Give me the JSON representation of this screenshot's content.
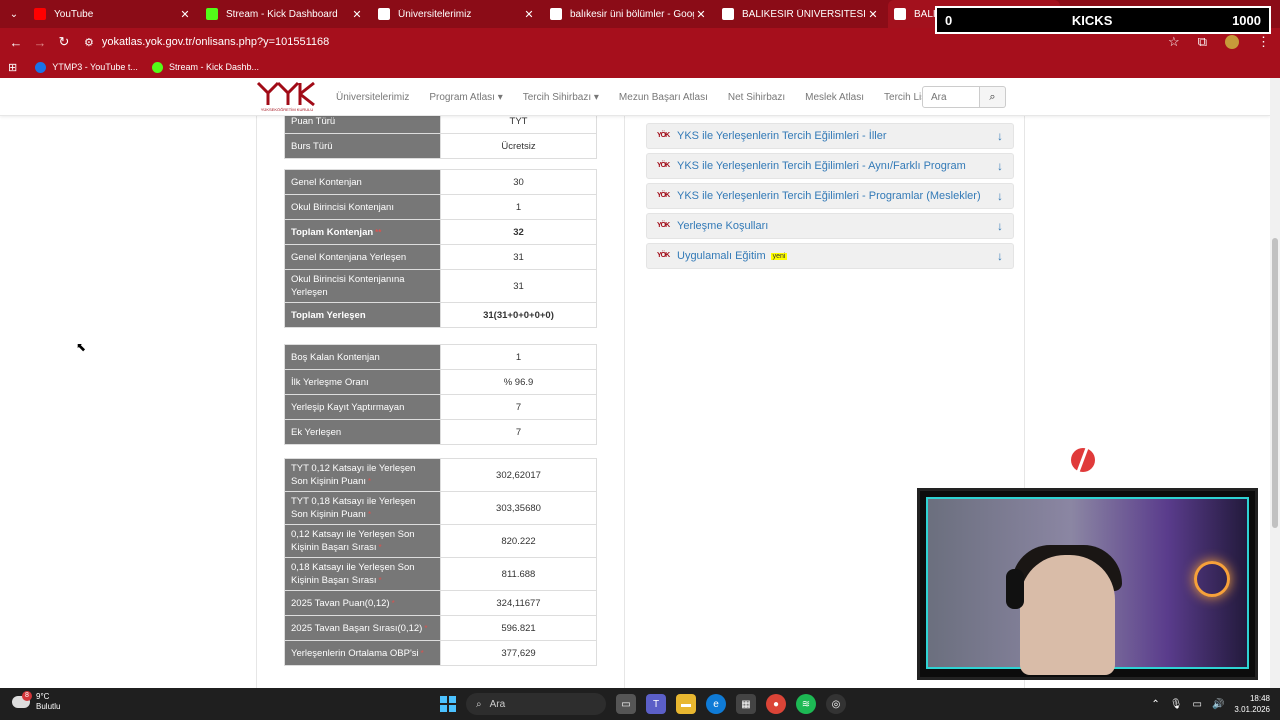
{
  "browser": {
    "tabs": [
      {
        "title": "YouTube",
        "icon": "youtube-icon",
        "active": false
      },
      {
        "title": "Stream - Kick Dashboard",
        "icon": "kick-icon",
        "active": false
      },
      {
        "title": "Üniversitelerimiz",
        "icon": "yok-icon",
        "active": false
      },
      {
        "title": "balıkesir üni bölümler - Google",
        "icon": "google-icon",
        "active": false
      },
      {
        "title": "BALIKESİR ÜNİVERSİTESİ'ndeki",
        "icon": "yok-icon",
        "active": false
      },
      {
        "title": "BALIKESİR ÜNİVERSİTESİ - Bal",
        "icon": "yok-icon",
        "active": true
      }
    ],
    "url": "yokatlas.yok.gov.tr/onlisans.php?y=101551168",
    "bookmarks": [
      {
        "label": "YTMP3 - YouTube t...",
        "color": "#1a73e8"
      },
      {
        "label": "Stream - Kick Dashb...",
        "color": "#53fc18"
      }
    ]
  },
  "kicks_overlay": {
    "left": "0",
    "title": "KICKS",
    "right": "1000"
  },
  "site": {
    "logo_text": "YÜKSEKÖĞRETİM KURULU",
    "menu": [
      "Üniversitelerimiz",
      "Program Atlası ▾",
      "Tercih Sihirbazı ▾",
      "Mezun Başarı Atlası",
      "Net Sihirbazı",
      "Meslek Atlası",
      "Tercih Listem"
    ],
    "search_placeholder": "Ara"
  },
  "table1": [
    {
      "label": "Puan Türü",
      "value": "TYT"
    },
    {
      "label": "Burs Türü",
      "value": "Ücretsiz"
    }
  ],
  "table2": [
    {
      "label": "Genel Kontenjan",
      "value": "30"
    },
    {
      "label": "Okul Birincisi Kontenjanı",
      "value": "1"
    },
    {
      "label": "Toplam Kontenjan",
      "value": "32",
      "mark": "**"
    },
    {
      "label": "Genel Kontenjana Yerleşen",
      "value": "31"
    },
    {
      "label": "Okul Birincisi Kontenjanına Yerleşen",
      "value": "31"
    },
    {
      "label": "Toplam Yerleşen",
      "value": "31(31+0+0+0+0)"
    }
  ],
  "table3": [
    {
      "label": "Boş Kalan Kontenjan",
      "value": "1"
    },
    {
      "label": "İlk Yerleşme Oranı",
      "value": "% 96.9"
    },
    {
      "label": "Yerleşip Kayıt Yaptırmayan",
      "value": "7"
    },
    {
      "label": "Ek Yerleşen",
      "value": "7"
    }
  ],
  "table4": [
    {
      "label": "TYT 0,12 Katsayı ile Yerleşen Son Kişinin Puanı",
      "value": "302,62017",
      "mark": "*"
    },
    {
      "label": "TYT 0,18 Katsayı ile Yerleşen Son Kişinin Puanı",
      "value": "303,35680",
      "mark": "*"
    },
    {
      "label": "0,12 Katsayı ile Yerleşen Son Kişinin Başarı Sırası",
      "value": "820.222",
      "mark": "*"
    },
    {
      "label": "0,18 Katsayı ile Yerleşen Son Kişinin Başarı Sırası",
      "value": "811.688",
      "mark": "*"
    },
    {
      "label": "2025 Tavan Puan(0,12)",
      "value": "324,11677",
      "mark": "*"
    },
    {
      "label": "2025 Tavan Başarı Sırası(0,12)",
      "value": "596.821",
      "mark": "*"
    },
    {
      "label": "Yerleşenlerin Ortalama OBP'si",
      "value": "377,629",
      "mark": "*"
    }
  ],
  "accordion": [
    {
      "label": "YKS ile Yerleşenlerin Tercih Eğilimleri - İller"
    },
    {
      "label": "YKS ile Yerleşenlerin Tercih Eğilimleri - Aynı/Farklı Program"
    },
    {
      "label": "YKS ile Yerleşenlerin Tercih Eğilimleri - Programlar (Meslekler)"
    },
    {
      "label": "Yerleşme Koşulları"
    },
    {
      "label": "Uygulamalı Eğitim",
      "badge": "yeni"
    }
  ],
  "taskbar": {
    "weather_temp": "9°C",
    "weather_desc": "Bulutlu",
    "weather_badge": "8",
    "search_label": "Ara",
    "time": "18:48",
    "date": "3.01.2026"
  }
}
